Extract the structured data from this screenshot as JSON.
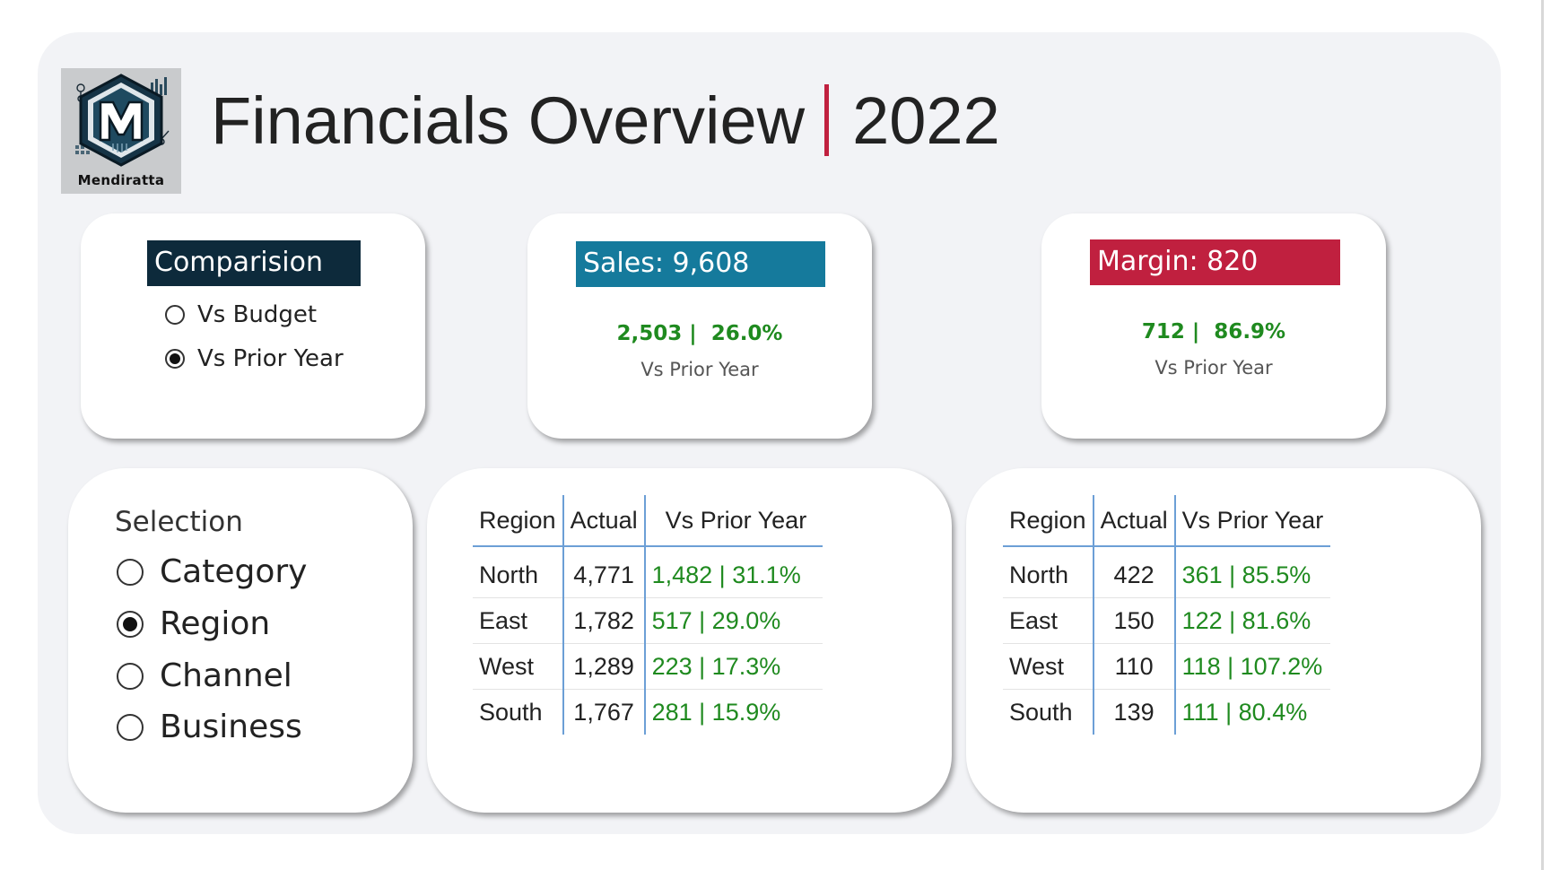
{
  "header": {
    "title": "Financials Overview",
    "year": "2022",
    "logo_text": "Mendiratta",
    "accent": "#c0203f"
  },
  "comparison": {
    "title": "Comparision",
    "options": [
      {
        "label": "Vs Budget",
        "selected": false
      },
      {
        "label": "Vs Prior Year",
        "selected": true
      }
    ]
  },
  "sales_card": {
    "title": "Sales: 9,608",
    "change": "2,503 |  26.0%",
    "label": "Vs Prior Year",
    "color": "#157a9c"
  },
  "margin_card": {
    "title": "Margin: 820",
    "change": "712 |  86.9%",
    "label": "Vs Prior Year",
    "color": "#c0203f"
  },
  "selection": {
    "title": "Selection",
    "options": [
      {
        "label": "Category",
        "selected": false
      },
      {
        "label": "Region",
        "selected": true
      },
      {
        "label": "Channel",
        "selected": false
      },
      {
        "label": "Business",
        "selected": false
      }
    ]
  },
  "sales_table": {
    "columns": [
      "Region",
      "Actual",
      "Vs Prior Year"
    ],
    "rows": [
      [
        "North",
        "4,771",
        "1,482 | 31.1%"
      ],
      [
        "East",
        "1,782",
        "517 | 29.0%"
      ],
      [
        "West",
        "1,289",
        "223 | 17.3%"
      ],
      [
        "South",
        "1,767",
        "281 | 15.9%"
      ]
    ]
  },
  "margin_table": {
    "columns": [
      "Region",
      "Actual",
      "Vs Prior Year"
    ],
    "rows": [
      [
        "North",
        "422",
        "361 | 85.5%"
      ],
      [
        "East",
        "150",
        "122 | 81.6%"
      ],
      [
        "West",
        "110",
        "118 | 107.2%"
      ],
      [
        "South",
        "139",
        "111 | 80.4%"
      ]
    ]
  },
  "colors": {
    "positive": "#1f8a1f",
    "comparison_header": "#0d2a3b",
    "table_rule": "#6c9fd6"
  }
}
